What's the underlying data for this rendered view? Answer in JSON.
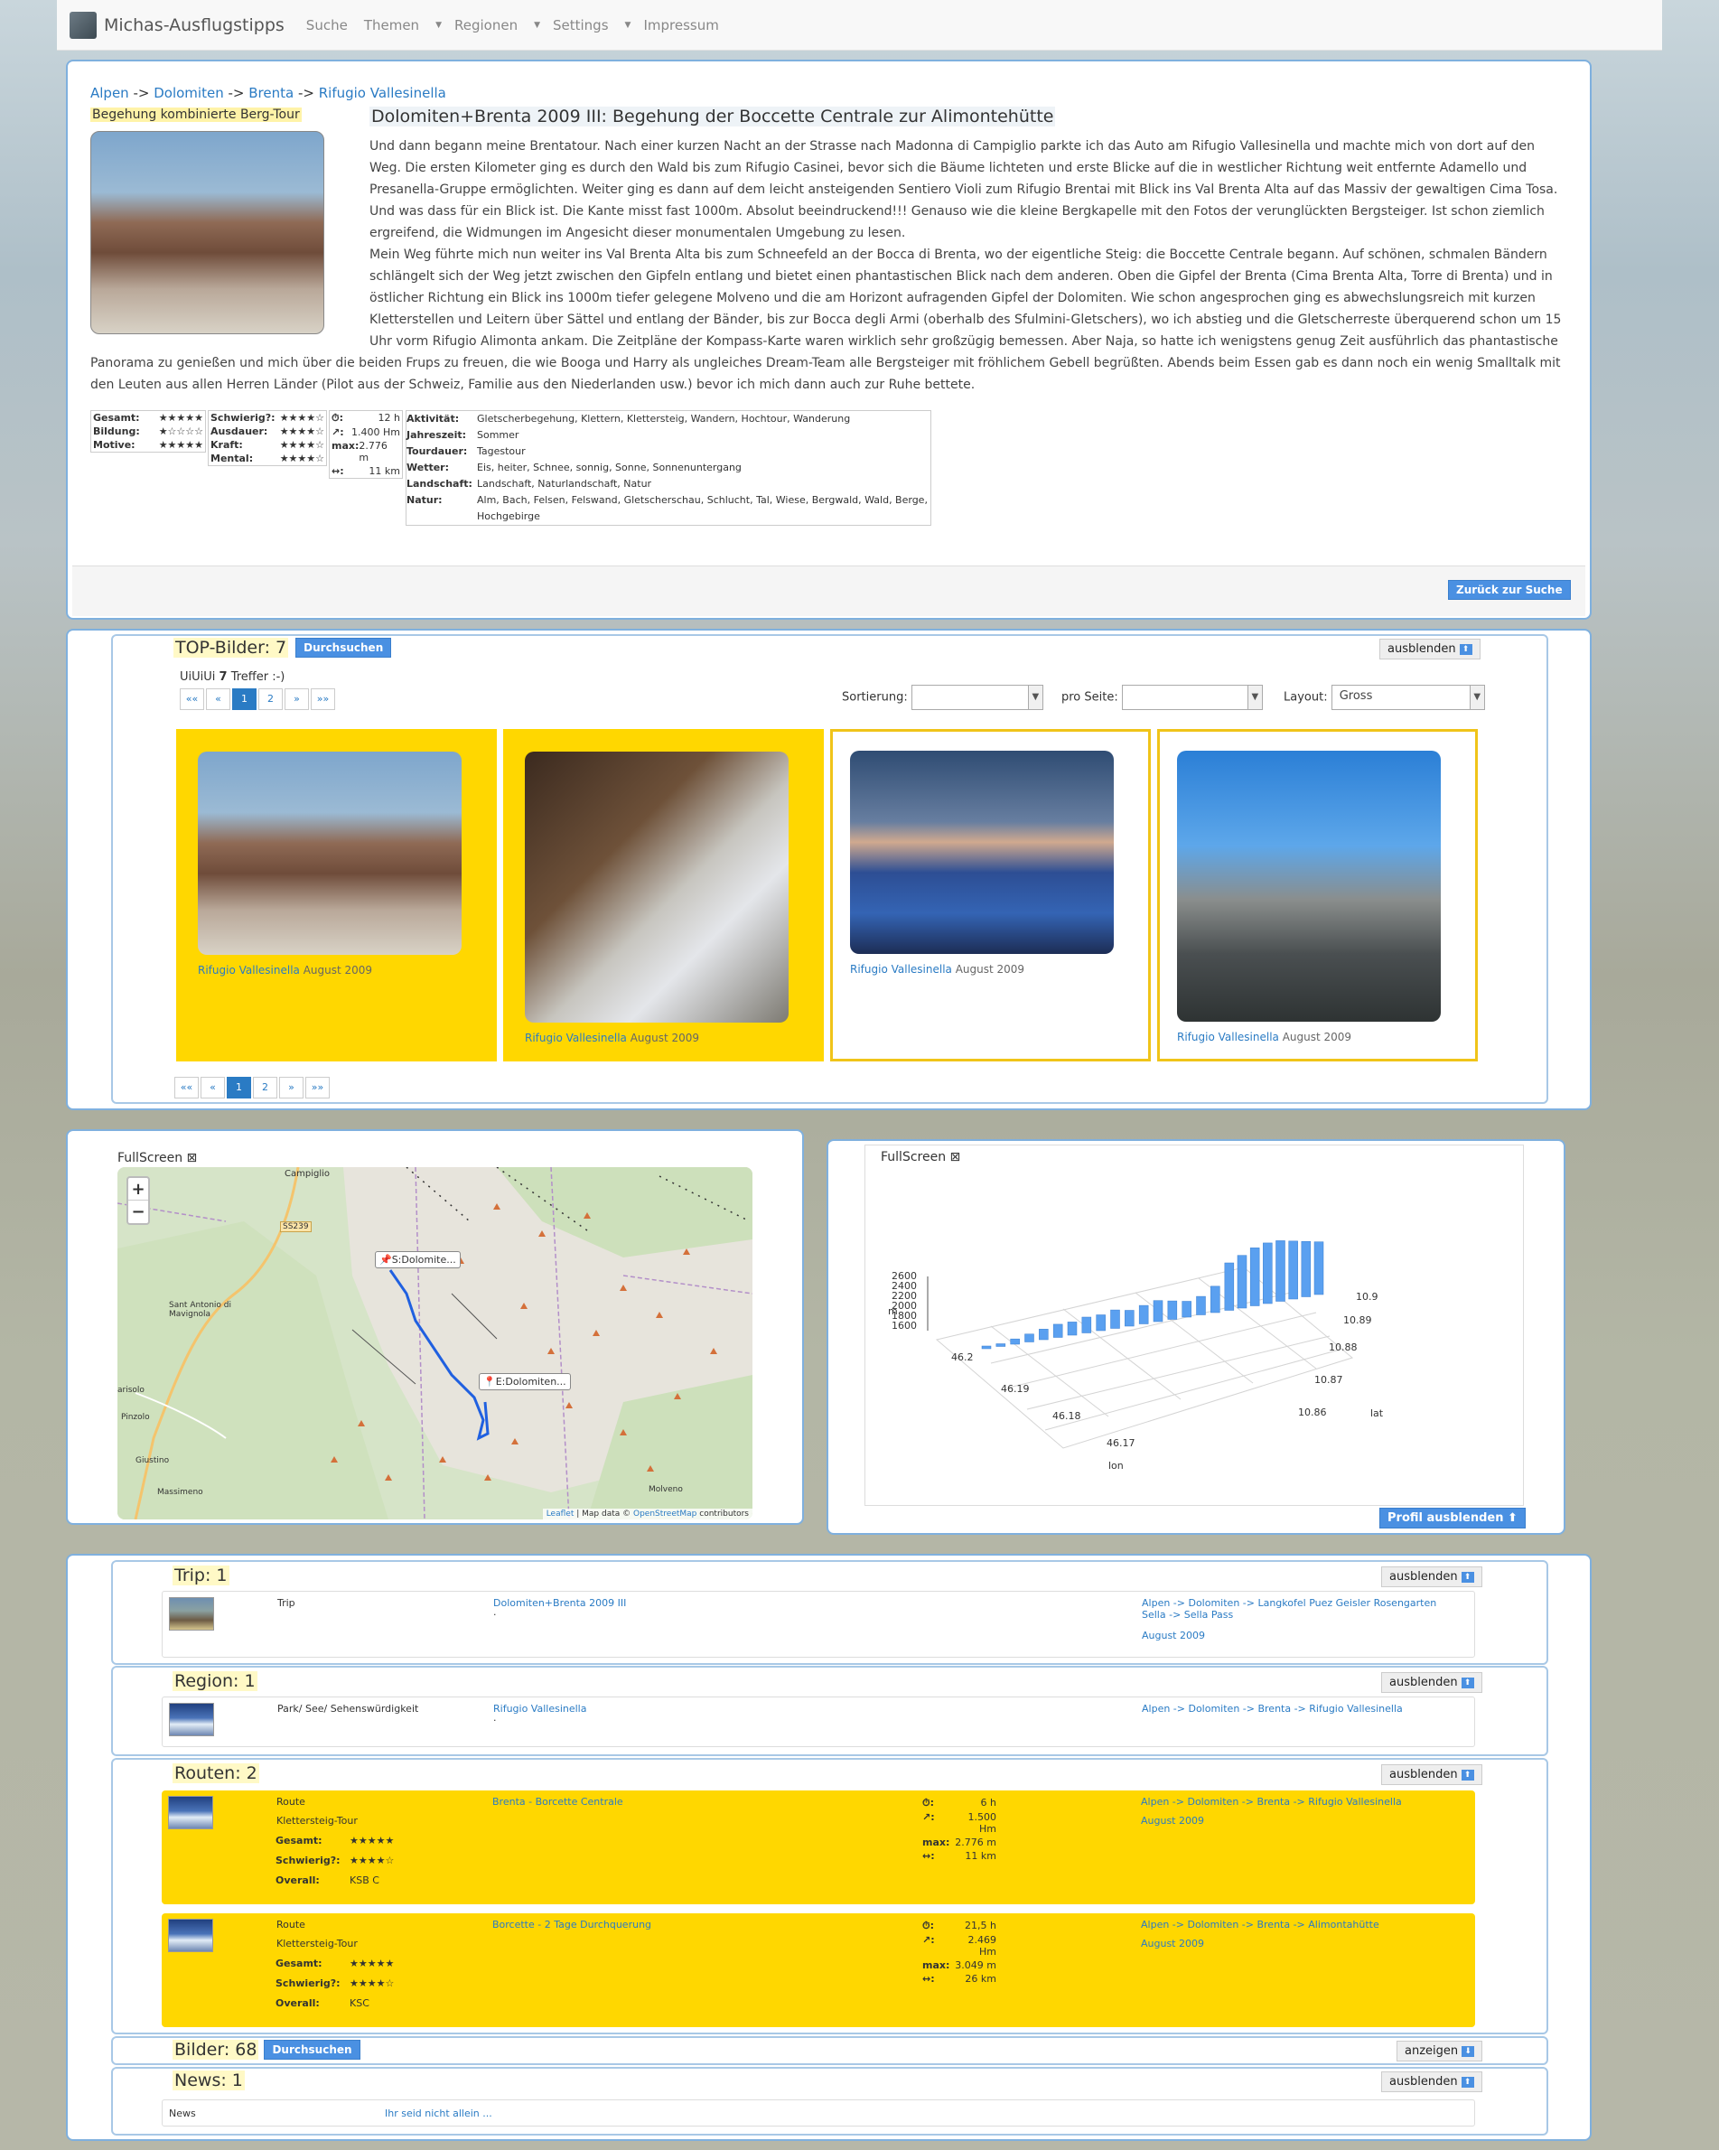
{
  "nav": {
    "brand": "Michas-Ausflugstipps",
    "items": [
      "Suche",
      "Themen",
      "Regionen",
      "Settings",
      "Impressum"
    ]
  },
  "breadcrumb": [
    "Alpen",
    "->",
    "Dolomiten",
    "->",
    "Brenta",
    "->",
    "Rifugio Vallesinella"
  ],
  "article": {
    "type_label": "Begehung kombinierte Berg-Tour",
    "title": "Dolomiten+Brenta 2009 III: Begehung der Boccette Centrale zur Alimontehütte",
    "para1": "Und dann begann meine Brentatour. Nach einer kurzen Nacht an der Strasse nach Madonna di Campiglio parkte ich das Auto am Rifugio Vallesinella und machte mich von dort auf den Weg. Die ersten Kilometer ging es durch den Wald bis zum Rifugio Casinei, bevor sich die Bäume lichteten und erste Blicke auf die in westlicher Richtung weit entfernte Adamello und Presanella-Gruppe ermöglichten. Weiter ging es dann auf dem leicht ansteigenden Sentiero Violi zum Rifugio Brentai mit Blick ins Val Brenta Alta auf das Massiv der gewaltigen Cima Tosa. Und was dass für ein Blick ist. Die Kante misst fast 1000m. Absolut beeindruckend!!! Genauso wie die kleine Bergkapelle mit den Fotos der verunglückten Bergsteiger. Ist schon ziemlich ergreifend, die Widmungen im Angesicht dieser monumentalen Umgebung zu lesen.",
    "para2": "Mein Weg führte mich nun weiter ins Val Brenta Alta bis zum Schneefeld an der Bocca di Brenta, wo der eigentliche Steig: die Boccette Centrale begann. Auf schönen, schmalen Bändern schlängelt sich der Weg jetzt zwischen den Gipfeln entlang und bietet einen phantastischen Blick nach dem anderen. Oben die Gipfel der Brenta (Cima Brenta Alta, Torre di Brenta) und in östlicher Richtung ein Blick ins 1000m tiefer gelegene Molveno und die am Horizont aufragenden Gipfel der Dolomiten. Wie schon angesprochen ging es abwechslungsreich mit kurzen Kletterstellen und Leitern über Sättel und entlang der Bänder, bis zur Bocca degli Armi (oberhalb des Sfulmini-Gletschers), wo ich abstieg und die Gletscherreste überquerend schon um 15 Uhr vorm Rifugio Alimonta ankam. Die Zeitpläne der Kompass-Karte waren wirklich sehr großzügig bemessen. Aber Naja, so hatte ich wenigstens genug Zeit ausführlich das phantastische Panorama zu genießen und mich über die beiden Frups zu freuen, die wie Booga und Harry als ungleiches Dream-Team alle Bergsteiger mit fröhlichem Gebell begrüßten. Abends beim Essen gab es dann noch ein wenig Smalltalk mit den Leuten aus allen Herren Länder (Pilot aus der Schweiz, Familie aus den Niederlanden usw.) bevor ich mich dann auch zur Ruhe bettete.",
    "ratings": [
      {
        "label": "Gesamt:",
        "stars": "★★★★★"
      },
      {
        "label": "Bildung:",
        "stars": "★☆☆☆☆"
      },
      {
        "label": "Motive:",
        "stars": "★★★★★"
      }
    ],
    "ratings2": [
      {
        "label": "Schwierig?:",
        "stars": "★★★★☆"
      },
      {
        "label": "Ausdauer:",
        "stars": "★★★★☆"
      },
      {
        "label": "Kraft:",
        "stars": "★★★★☆"
      },
      {
        "label": "Mental:",
        "stars": "★★★★☆"
      }
    ],
    "metrics": [
      {
        "label": "⏱:",
        "value": "12 h"
      },
      {
        "label": "↗:",
        "value": "1.400 Hm"
      },
      {
        "label": "max:",
        "value": "2.776 m"
      },
      {
        "label": "↔:",
        "value": "11 km"
      }
    ],
    "attributes": [
      {
        "label": "Aktivität:",
        "value": "Gletscherbegehung, Klettern, Klettersteig, Wandern, Hochtour, Wanderung"
      },
      {
        "label": "Jahreszeit:",
        "value": "Sommer"
      },
      {
        "label": "Tourdauer:",
        "value": "Tagestour"
      },
      {
        "label": "Wetter:",
        "value": "Eis, heiter, Schnee, sonnig, Sonne, Sonnenuntergang"
      },
      {
        "label": "Landschaft:",
        "value": "Landschaft, Naturlandschaft, Natur"
      },
      {
        "label": "Natur:",
        "value": "Alm, Bach, Felsen, Felswand, Gletscherschau, Schlucht, Tal, Wiese, Bergwald, Wald, Berge, Hochgebirge"
      }
    ],
    "back_button": "Zurück zur Suche"
  },
  "top_images": {
    "title": "TOP-Bilder: 7",
    "browse_button": "Durchsuchen",
    "hide_button": "ausblenden",
    "hits_text": "UiUiUi",
    "hits_count": "7",
    "hits_suffix": "Treffer :-)",
    "pager": [
      "««",
      "«",
      "1",
      "2",
      "»",
      "»»"
    ],
    "sort_label": "Sortierung:",
    "per_page_label": "pro Seite:",
    "layout_label": "Layout:",
    "layout_value": "Gross",
    "cards": [
      {
        "caption": "Rifugio Vallesinella",
        "date": "August 2009"
      },
      {
        "caption": "Rifugio Vallesinella",
        "date": "August 2009"
      },
      {
        "caption": "Rifugio Vallesinella",
        "date": "August 2009"
      },
      {
        "caption": "Rifugio Vallesinella",
        "date": "August 2009"
      }
    ]
  },
  "map": {
    "fullscreen": "FullScreen",
    "zoom_in": "+",
    "zoom_out": "−",
    "marker_start": "S:Dolomite...",
    "marker_end": "E:Dolomiten...",
    "places": [
      "Campiglio",
      "SS239",
      "Sant Antonio di Mavignola",
      "Pinzolo",
      "arisolo",
      "Giustino",
      "Massimeno",
      "Molveno"
    ],
    "attribution_leaflet": "Leaflet",
    "attribution_mid": "| Map data ©",
    "attribution_osm": "OpenStreetMap",
    "attribution_end": "contributors"
  },
  "profile": {
    "fullscreen": "FullScreen",
    "hide_button": "Profil ausblenden",
    "chart_data": {
      "type": "bar",
      "title": "",
      "z_ticks": [
        "2600",
        "2400",
        "2200",
        "2000",
        "1800",
        "1600"
      ],
      "z_unit": "m",
      "lat_ticks": [
        "46.2",
        "46.19",
        "46.18",
        "46.17"
      ],
      "lat_label": "lat",
      "lon_ticks": [
        "10.9",
        "10.89",
        "10.88",
        "10.87",
        "10.86"
      ],
      "lon_label": "lon",
      "values": [
        1600,
        1650,
        1700,
        1750,
        1800,
        1850,
        1850,
        1900,
        1900,
        1950,
        1900,
        1950,
        2000,
        1950,
        1900,
        1950,
        2100,
        2500,
        2600,
        2700,
        2750,
        2750,
        2700,
        2650,
        2600
      ]
    }
  },
  "related": {
    "trip": {
      "title": "Trip: 1",
      "hide_button": "ausblenden",
      "type": "Trip",
      "name": "Dolomiten+Brenta 2009 III",
      "dot": ".",
      "path": "Alpen -> Dolomiten -> Langkofel Puez Geisler Rosengarten Sella -> Sella Pass",
      "date": "August 2009"
    },
    "region": {
      "title": "Region: 1",
      "hide_button": "ausblenden",
      "type": "Park/ See/ Sehenswürdigkeit",
      "name": "Rifugio Vallesinella",
      "dot": ".",
      "path": "Alpen -> Dolomiten -> Brenta -> Rifugio Vallesinella"
    },
    "routes": {
      "title": "Routen: 2",
      "hide_button": "ausblenden",
      "items": [
        {
          "type": "Route",
          "subtype": "Klettersteig-Tour",
          "name": "Brenta - Borcette Centrale",
          "gesamt": "★★★★★",
          "schwierig": "★★★★☆",
          "overall": "KSB C",
          "time": "6 h",
          "ascent": "1.500 Hm",
          "max": "2.776 m",
          "dist": "11 km",
          "path": "Alpen -> Dolomiten -> Brenta -> Rifugio Vallesinella",
          "date": "August 2009"
        },
        {
          "type": "Route",
          "subtype": "Klettersteig-Tour",
          "name": "Borcette - 2 Tage Durchquerung",
          "gesamt": "★★★★★",
          "schwierig": "★★★★☆",
          "overall": "KSC",
          "time": "21,5 h",
          "ascent": "2.469 Hm",
          "max": "3.049 m",
          "dist": "26 km",
          "path": "Alpen -> Dolomiten -> Brenta -> Alimontahütte",
          "date": "August 2009"
        }
      ],
      "labels": {
        "gesamt": "Gesamt:",
        "schwierig": "Schwierig?:",
        "overall": "Overall:",
        "time": "⏱:",
        "ascent": "↗:",
        "max": "max:",
        "dist": "↔:"
      }
    },
    "images": {
      "title": "Bilder: 68",
      "browse_button": "Durchsuchen",
      "show_button": "anzeigen"
    },
    "news": {
      "title": "News: 1",
      "hide_button": "ausblenden",
      "type": "News",
      "name": "Ihr seid nicht allein ..."
    }
  },
  "colors": {
    "accent": "#2a7bc4",
    "highlight": "#ffd700",
    "panel_border": "#7fb0de",
    "button": "#4a90e2"
  }
}
